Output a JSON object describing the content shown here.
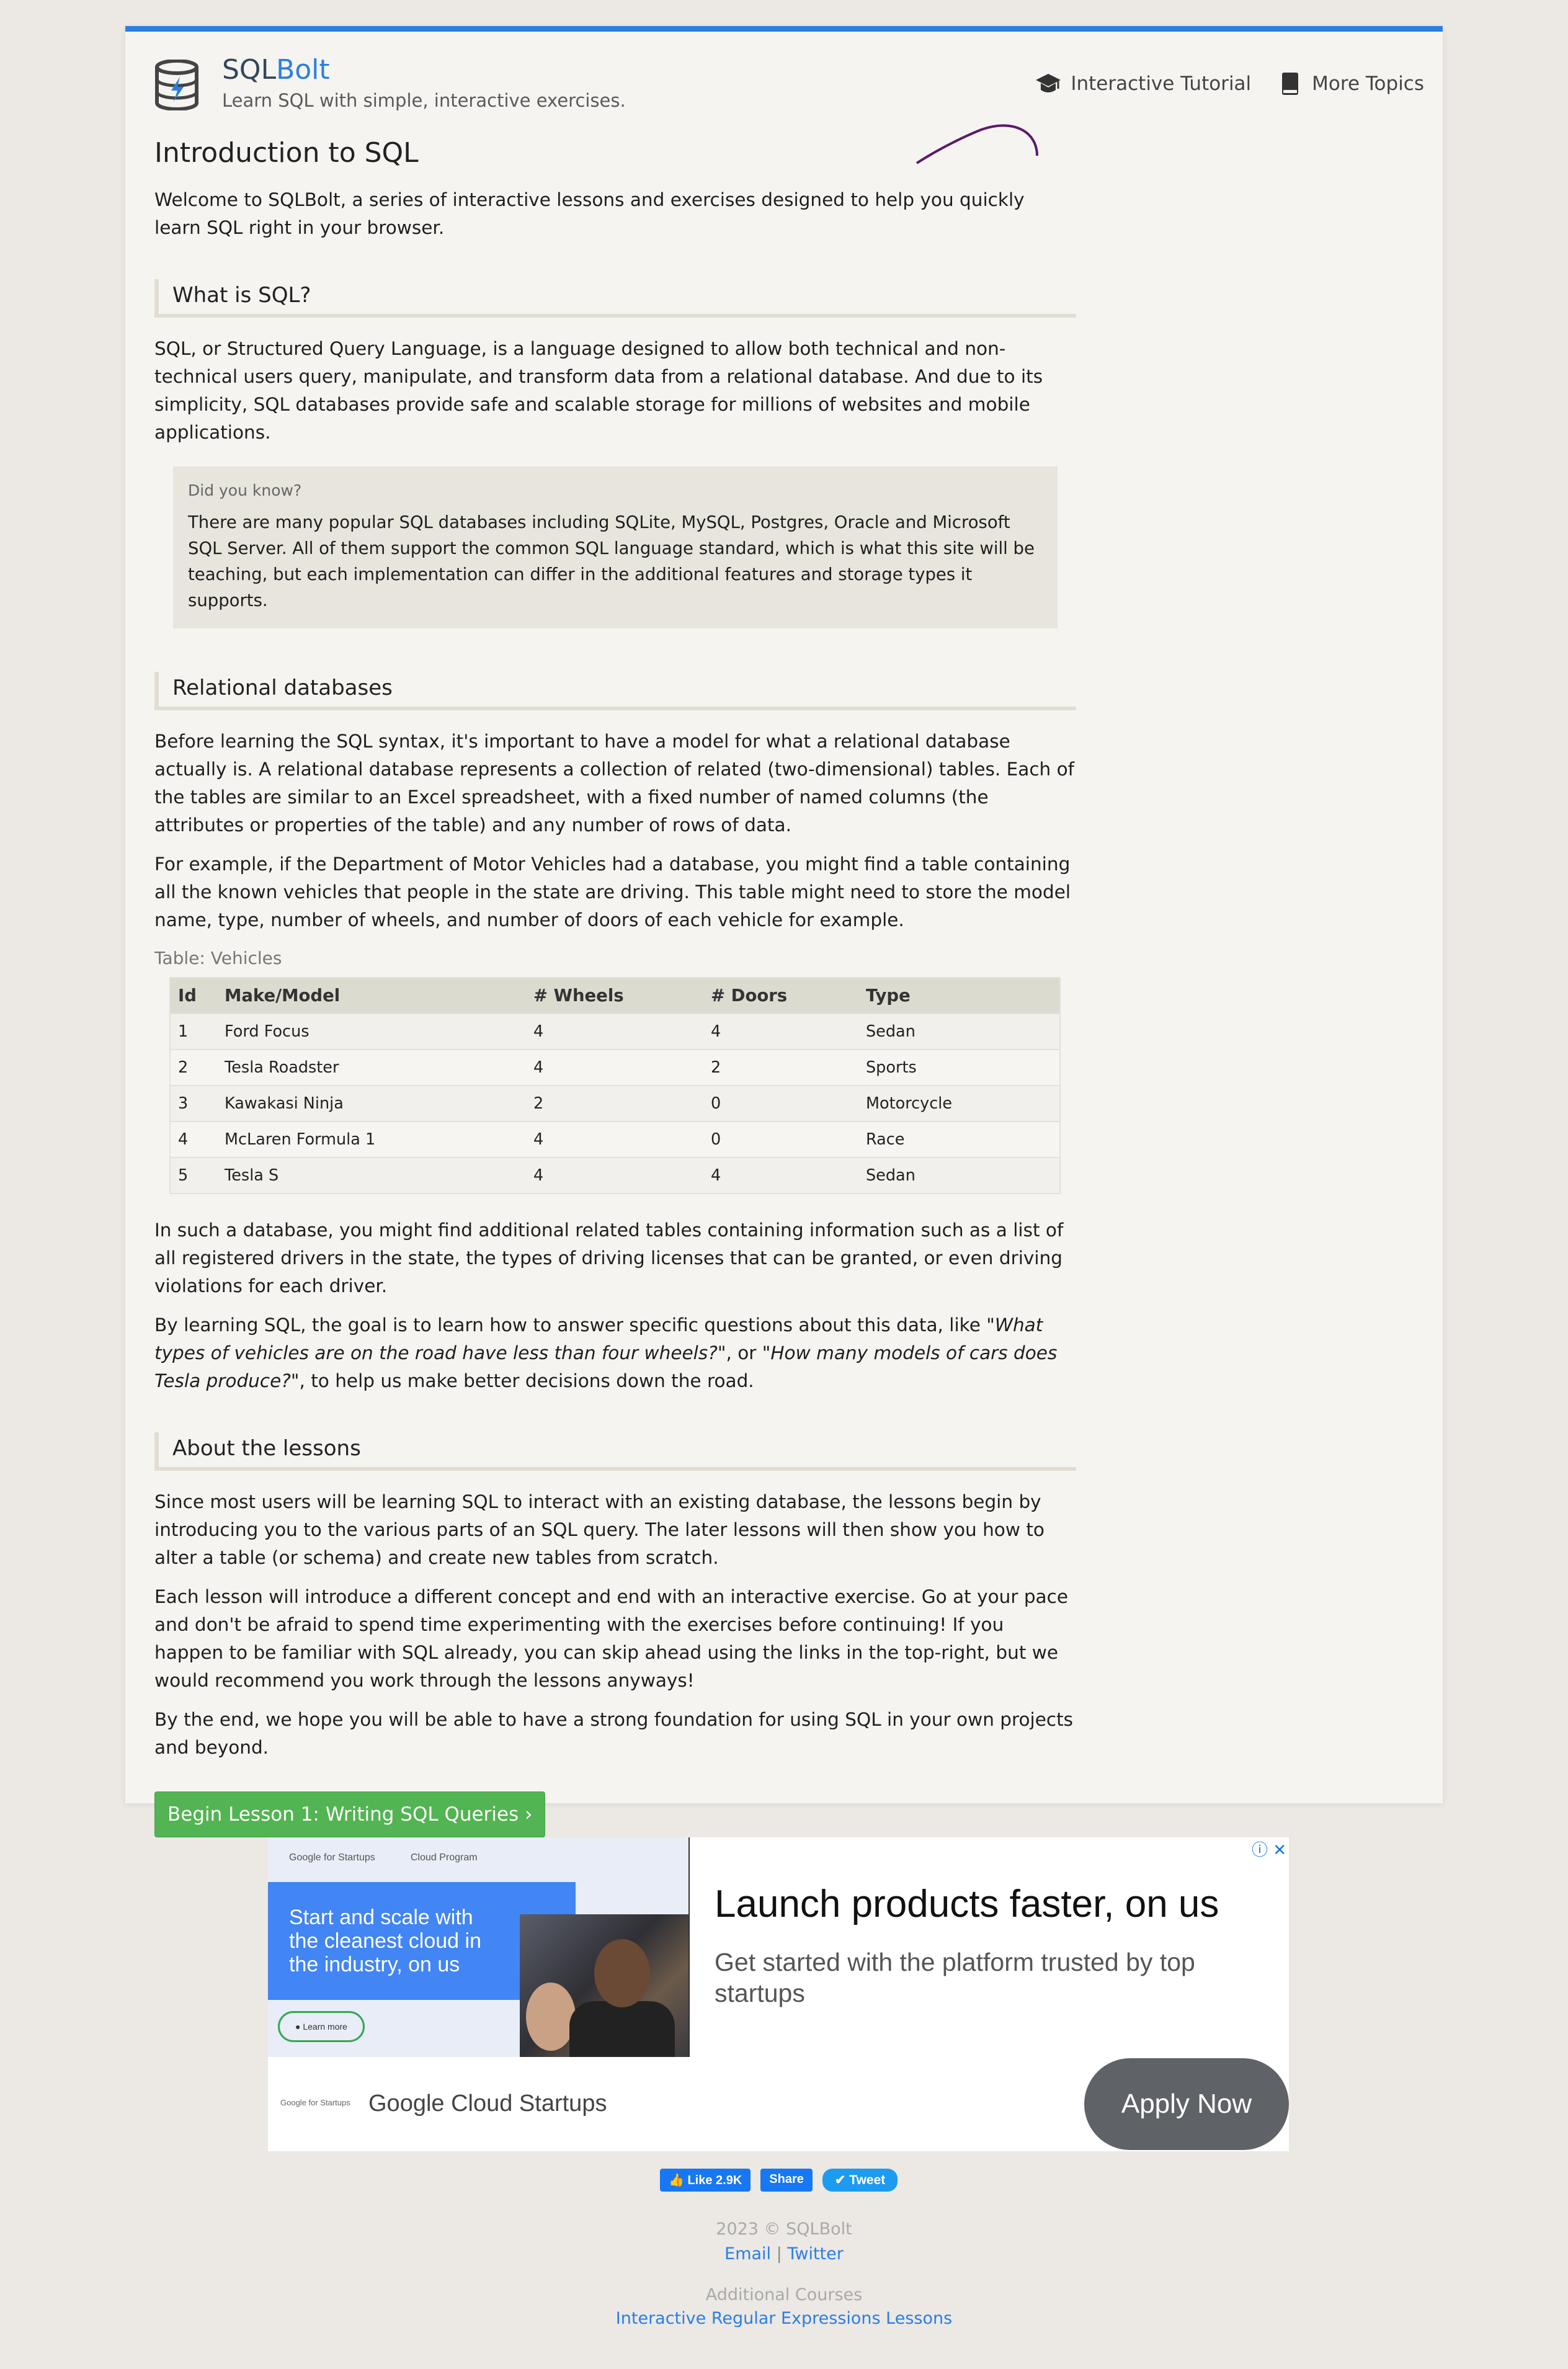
{
  "header": {
    "brand_sql": "SQL",
    "brand_bolt": "Bolt",
    "tagline": "Learn SQL with simple, interactive exercises.",
    "nav": [
      {
        "label": "Interactive Tutorial",
        "icon": "graduation-cap-icon"
      },
      {
        "label": "More Topics",
        "icon": "book-icon"
      }
    ]
  },
  "main": {
    "title": "Introduction to SQL",
    "intro": "Welcome to SQLBolt, a series of interactive lessons and exercises designed to help you quickly learn SQL right in your browser.",
    "sections": [
      {
        "heading": "What is SQL?",
        "paragraphs": [
          "SQL, or Structured Query Language, is a language designed to allow both technical and non-technical users query, manipulate, and transform data from a relational database. And due to its simplicity, SQL databases provide safe and scalable storage for millions of websites and mobile applications."
        ]
      },
      {
        "heading": "Relational databases",
        "paragraphs": [
          "Before learning the SQL syntax, it's important to have a model for what a relational database actually is. A relational database represents a collection of related (two-dimensional) tables. Each of the tables are similar to an Excel spreadsheet, with a fixed number of named columns (the attributes or properties of the table) and any number of rows of data.",
          "For example, if the Department of Motor Vehicles had a database, you might find a table containing all the known vehicles that people in the state are driving. This table might need to store the model name, type, number of wheels, and number of doors of each vehicle for example.",
          "In such a database, you might find additional related tables containing information such as a list of all registered drivers in the state, the types of driving licenses that can be granted, or even driving violations for each driver."
        ],
        "closing": {
          "pre": "By learning SQL, the goal is to learn how to answer specific questions about this data, like ",
          "q1": "\"What types of vehicles are on the road have less than four wheels?\"",
          "mid": ", or \"",
          "q2": "How many models of cars does Tesla produce?",
          "post": "\", to help us make better decisions down the road."
        }
      },
      {
        "heading": "About the lessons",
        "paragraphs": [
          "Since most users will be learning SQL to interact with an existing database, the lessons begin by introducing you to the various parts of an SQL query. The later lessons will then show you how to alter a table (or schema) and create new tables from scratch.",
          "Each lesson will introduce a different concept and end with an interactive exercise. Go at your pace and don't be afraid to spend time experimenting with the exercises before continuing! If you happen to be familiar with SQL already, you can skip ahead using the links in the top-right, but we would recommend you work through the lessons anyways!",
          "By the end, we hope you will be able to have a strong foundation for using SQL in your own projects and beyond."
        ]
      }
    ],
    "did_you_know": {
      "label": "Did you know?",
      "body": "There are many popular SQL databases including SQLite, MySQL, Postgres, Oracle and Microsoft SQL Server. All of them support the common SQL language standard, which is what this site will be teaching, but each implementation can differ in the additional features and storage types it supports."
    },
    "table": {
      "caption": "Table: Vehicles",
      "columns": [
        "Id",
        "Make/Model",
        "# Wheels",
        "# Doors",
        "Type"
      ],
      "rows": [
        [
          "1",
          "Ford Focus",
          "4",
          "4",
          "Sedan"
        ],
        [
          "2",
          "Tesla Roadster",
          "4",
          "2",
          "Sports"
        ],
        [
          "3",
          "Kawakasi Ninja",
          "2",
          "0",
          "Motorcycle"
        ],
        [
          "4",
          "McLaren Formula 1",
          "4",
          "0",
          "Race"
        ],
        [
          "5",
          "Tesla S",
          "4",
          "4",
          "Sedan"
        ]
      ]
    },
    "cta_button": "Begin Lesson 1: Writing SQL Queries ›"
  },
  "ad": {
    "google_for_startups": "Google for Startups",
    "cloud_program": "Cloud Program",
    "left_text_1": "Start and scale with",
    "left_text_2": "the cleanest cloud in",
    "left_text_3": "the industry, on us",
    "learn_more": "● Learn more",
    "headline": "Launch products faster, on us",
    "subhead": "Get started with the platform trusted by top startups",
    "footer_logo": "Google for Startups",
    "footer_name": "Google Cloud Startups",
    "apply": "Apply Now"
  },
  "social": {
    "like": "👍 Like 2.9K",
    "share": "Share",
    "tweet": "✔ Tweet"
  },
  "footer": {
    "copyright": "2023 © SQLBolt",
    "email": "Email",
    "separator": "|",
    "twitter": "Twitter",
    "additional": "Additional Courses",
    "regex": "Interactive Regular Expressions Lessons"
  },
  "colors": {
    "accent": "#2a7ee3",
    "button_green": "#52b452",
    "page_bg": "#f5f4f1",
    "body_bg": "#ece8e4"
  }
}
